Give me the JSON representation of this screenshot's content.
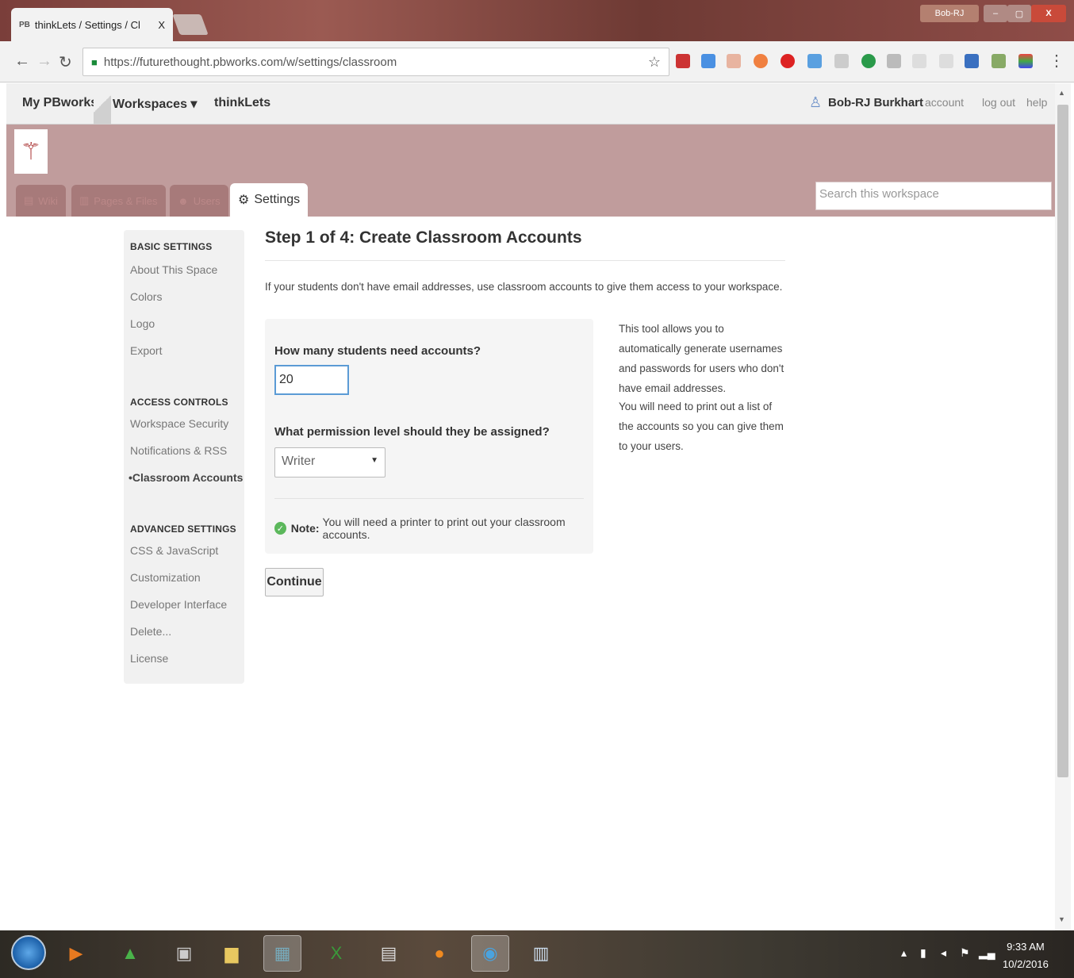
{
  "browser": {
    "tab_favicon": "PB",
    "tab_title": "thinkLets / Settings / Cl",
    "tab_close": "X",
    "user_chip": "Bob-RJ",
    "url": "https://futurethought.pbworks.com/w/settings/classroom",
    "window_min": "–",
    "window_max": "▢",
    "window_close": "X"
  },
  "topbar": {
    "my_pbworks": "My PBworks",
    "workspaces": "Workspaces ▾",
    "workspace_name": "thinkLets",
    "user_name": "Bob-RJ Burkhart",
    "account": "account",
    "log_out": "log out",
    "help": "help"
  },
  "tabs": [
    {
      "label": "Wiki",
      "icon": "page-icon"
    },
    {
      "label": "Pages & Files",
      "icon": "folder-icon"
    },
    {
      "label": "Users",
      "icon": "users-icon"
    },
    {
      "label": "Settings",
      "icon": "gear-icon"
    }
  ],
  "search": {
    "placeholder": "Search this workspace"
  },
  "sidebar": {
    "basic_heading": "BASIC SETTINGS",
    "basic": [
      "About This Space",
      "Colors",
      "Logo",
      "Export"
    ],
    "access_heading": "ACCESS CONTROLS",
    "access": [
      "Workspace Security",
      "Notifications & RSS",
      "Classroom Accounts"
    ],
    "advanced_heading": "ADVANCED SETTINGS",
    "advanced": [
      "CSS & JavaScript",
      "Customization",
      "Developer Interface",
      "Delete...",
      "License"
    ]
  },
  "main": {
    "title": "Step 1 of 4: Create Classroom Accounts",
    "intro": "If your students don't have email addresses, use classroom accounts to give them access to your workspace.",
    "q1": "How many students need accounts?",
    "q1_value": "20",
    "q2": "What permission level should they be assigned?",
    "q2_value": "Writer",
    "note_label": "Note:",
    "note_text": "You will need a printer to print out your classroom accounts.",
    "continue": "Continue",
    "help1": "This tool allows you to automatically generate usernames and passwords for users who don't have email addresses.",
    "help2": "You will need to print out a list of the accounts so you can give them to your users."
  },
  "taskbar": {
    "time": "9:33 AM",
    "date": "10/2/2016"
  }
}
